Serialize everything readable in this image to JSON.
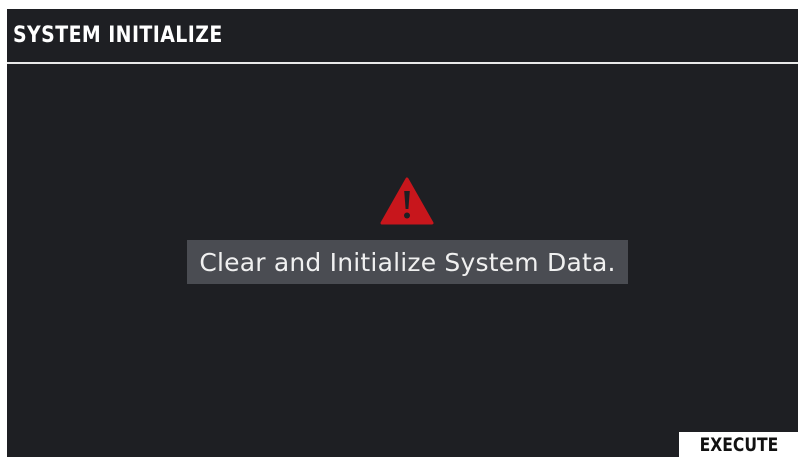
{
  "screen": {
    "title": "SYSTEM INITIALIZE",
    "message": "Clear and Initialize System Data.",
    "warning_icon": "warning-triangle-icon",
    "execute_label": "EXECUTE"
  },
  "colors": {
    "background": "#1e1f23",
    "title_divider": "#e9e9e9",
    "message_box": "#4a4c52",
    "warning_red": "#c8161c",
    "button_bg": "#ffffff"
  }
}
